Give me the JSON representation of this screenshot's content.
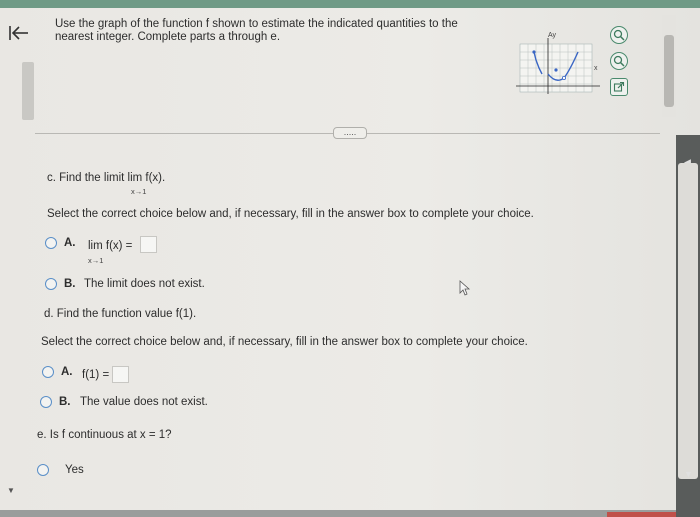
{
  "header": {
    "back_icon": "back-arrow-icon",
    "instructions": "Use the graph of the function f shown to estimate the indicated quantities to the nearest integer. Complete parts a through e."
  },
  "graph_thumbnail": {
    "y_label": "Ay",
    "x_label": "x"
  },
  "toolbar": {
    "icons": [
      "zoom-in-icon",
      "zoom-out-icon",
      "external-link-icon"
    ],
    "more_label": "....."
  },
  "part_c": {
    "prompt": "c. Find the limit lim f(x).",
    "limit_sub": "x→1",
    "instruction": "Select the correct choice below and, if necessary, fill in the answer box to complete your choice.",
    "option_a_letter": "A.",
    "option_a_text": "lim f(x) =",
    "option_a_sub": "x→1",
    "option_b_letter": "B.",
    "option_b_text": "The limit does not exist."
  },
  "part_d": {
    "prompt": "d. Find the function value f(1).",
    "instruction": "Select the correct choice below and, if necessary, fill in the answer box to complete your choice.",
    "option_a_letter": "A.",
    "option_a_text": "f(1) =",
    "option_b_letter": "B.",
    "option_b_text": "The value does not exist."
  },
  "part_e": {
    "prompt": "e. Is f continuous at x = 1?",
    "option_yes": "Yes"
  },
  "colors": {
    "accent_green": "#4a8a6d",
    "radio_blue": "#5a8fc8",
    "top_bar": "#6f9a86"
  }
}
